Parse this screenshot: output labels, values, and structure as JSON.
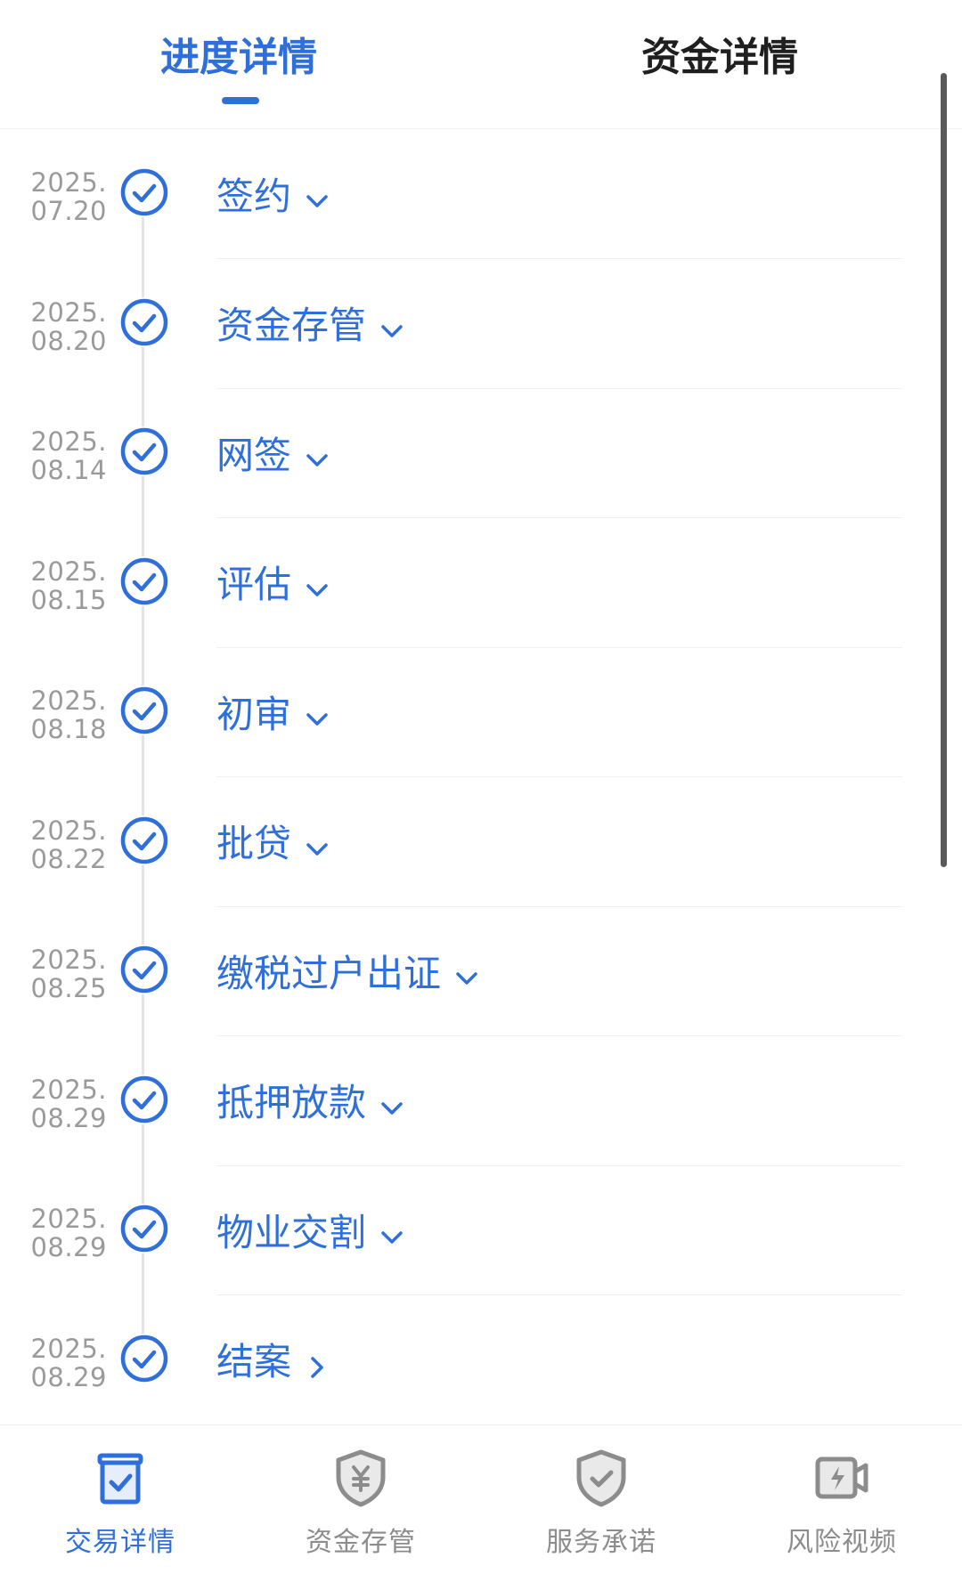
{
  "tabs": [
    {
      "label": "进度详情",
      "active": true
    },
    {
      "label": "资金详情",
      "active": false
    }
  ],
  "colors": {
    "accent": "#2f6fdb",
    "date_text": "#9a9a9a",
    "nav_inactive": "#8c8c8c",
    "line": "#e4e4e4"
  },
  "steps": [
    {
      "year": "2025.",
      "date": "07.20",
      "label": "签约",
      "icon": "check-circle-icon",
      "arrow": "chevron-down-icon"
    },
    {
      "year": "2025.",
      "date": "08.20",
      "label": "资金存管",
      "icon": "check-circle-icon",
      "arrow": "chevron-down-icon"
    },
    {
      "year": "2025.",
      "date": "08.14",
      "label": "网签",
      "icon": "check-circle-icon",
      "arrow": "chevron-down-icon"
    },
    {
      "year": "2025.",
      "date": "08.15",
      "label": "评估",
      "icon": "check-circle-icon",
      "arrow": "chevron-down-icon"
    },
    {
      "year": "2025.",
      "date": "08.18",
      "label": "初审",
      "icon": "check-circle-icon",
      "arrow": "chevron-down-icon"
    },
    {
      "year": "2025.",
      "date": "08.22",
      "label": "批贷",
      "icon": "check-circle-icon",
      "arrow": "chevron-down-icon"
    },
    {
      "year": "2025.",
      "date": "08.25",
      "label": "缴税过户出证",
      "icon": "check-circle-icon",
      "arrow": "chevron-down-icon"
    },
    {
      "year": "2025.",
      "date": "08.29",
      "label": "抵押放款",
      "icon": "check-circle-icon",
      "arrow": "chevron-down-icon"
    },
    {
      "year": "2025.",
      "date": "08.29",
      "label": "物业交割",
      "icon": "check-circle-icon",
      "arrow": "chevron-down-icon"
    },
    {
      "year": "2025.",
      "date": "08.29",
      "label": "结案",
      "icon": "check-circle-icon",
      "arrow": "chevron-right-icon"
    }
  ],
  "bottom_nav": [
    {
      "label": "交易详情",
      "icon": "document-check-icon",
      "active": true
    },
    {
      "label": "资金存管",
      "icon": "shield-yuan-icon",
      "active": false
    },
    {
      "label": "服务承诺",
      "icon": "shield-check-icon",
      "active": false
    },
    {
      "label": "风险视频",
      "icon": "video-bolt-icon",
      "active": false
    }
  ]
}
